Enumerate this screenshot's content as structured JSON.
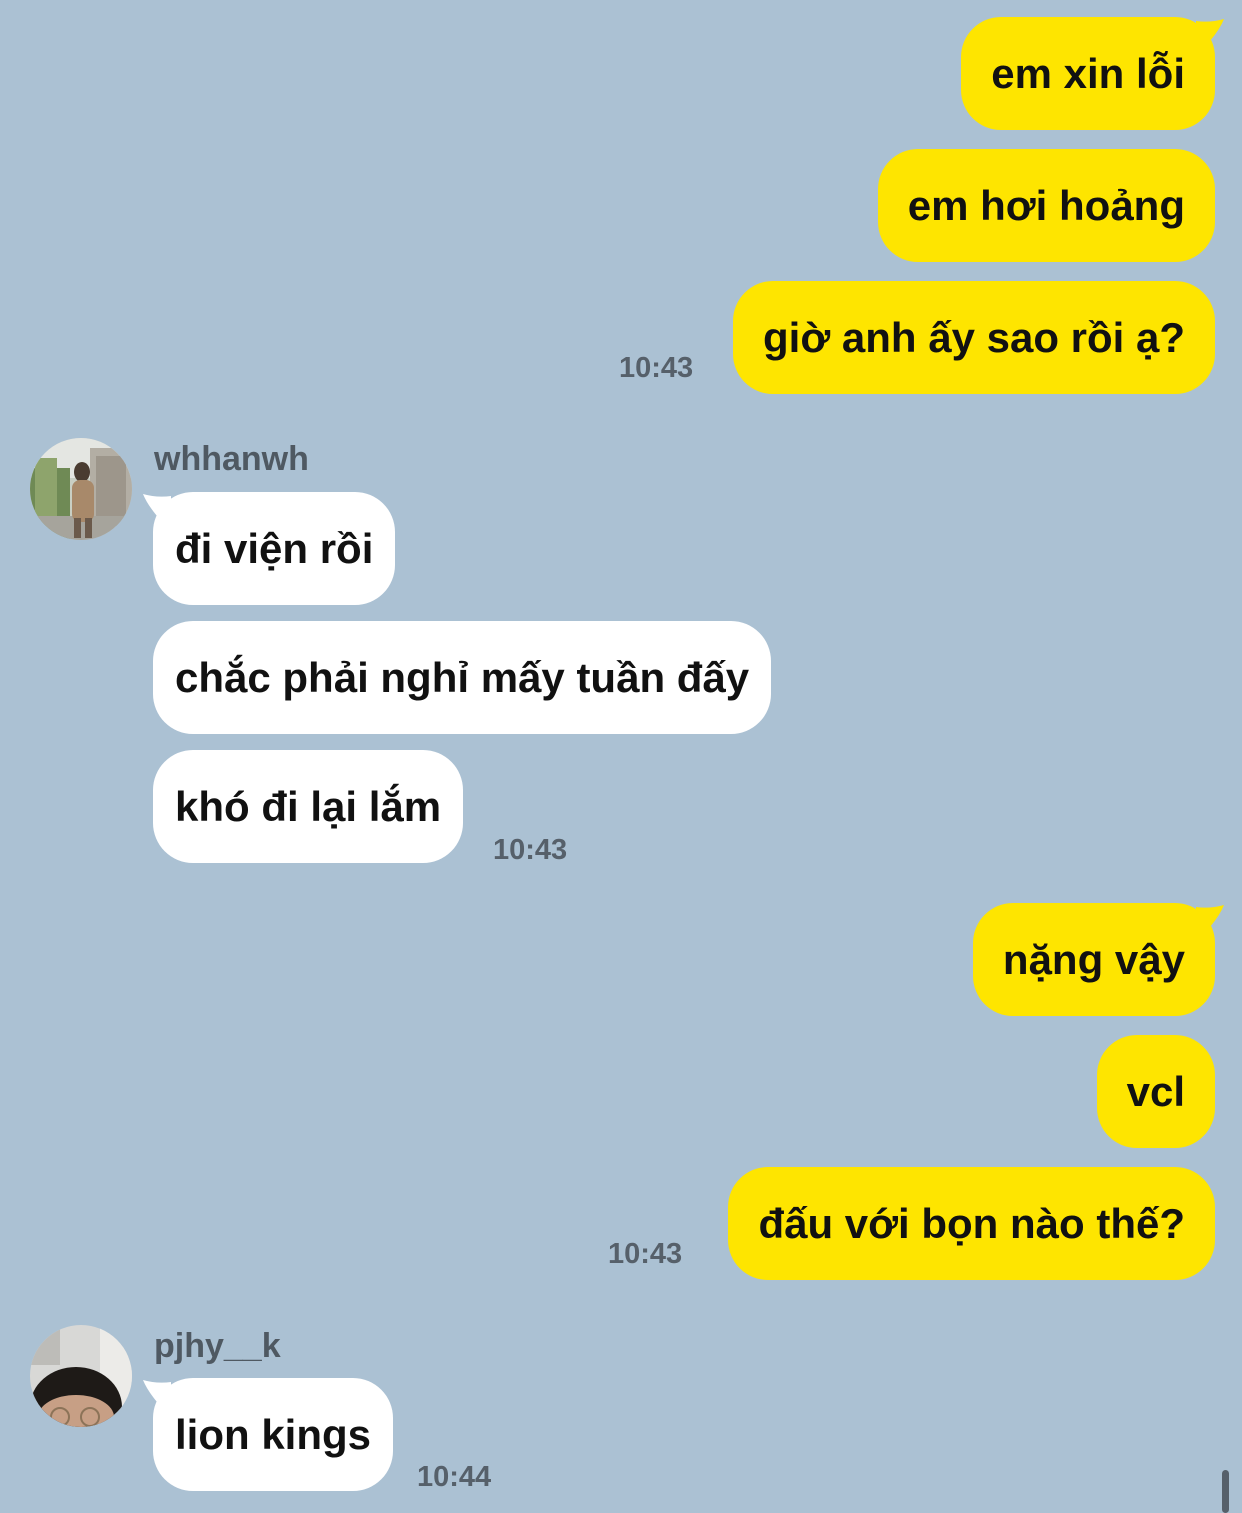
{
  "colors": {
    "background": "#abc1d3",
    "outgoing_bubble": "#fee500",
    "incoming_bubble": "#ffffff",
    "timestamp": "#56606a"
  },
  "outgoing_group_1": {
    "messages": [
      "em xin lỗi",
      "em hơi hoảng",
      "giờ anh ấy sao rồi ạ?"
    ],
    "time": "10:43"
  },
  "incoming_group_1": {
    "sender": "whhanwh",
    "avatar_icon": "avatar-photo-person-icon",
    "messages": [
      "đi viện rồi",
      "chắc phải nghỉ mấy tuần đấy",
      "khó đi lại lắm"
    ],
    "time": "10:43"
  },
  "outgoing_group_2": {
    "messages": [
      "nặng vậy",
      "vcl",
      "đấu với bọn nào thế?"
    ],
    "time": "10:43"
  },
  "incoming_group_2": {
    "sender": "pjhy__k",
    "avatar_icon": "avatar-photo-face-icon",
    "messages": [
      "lion kings"
    ],
    "time": "10:44"
  }
}
